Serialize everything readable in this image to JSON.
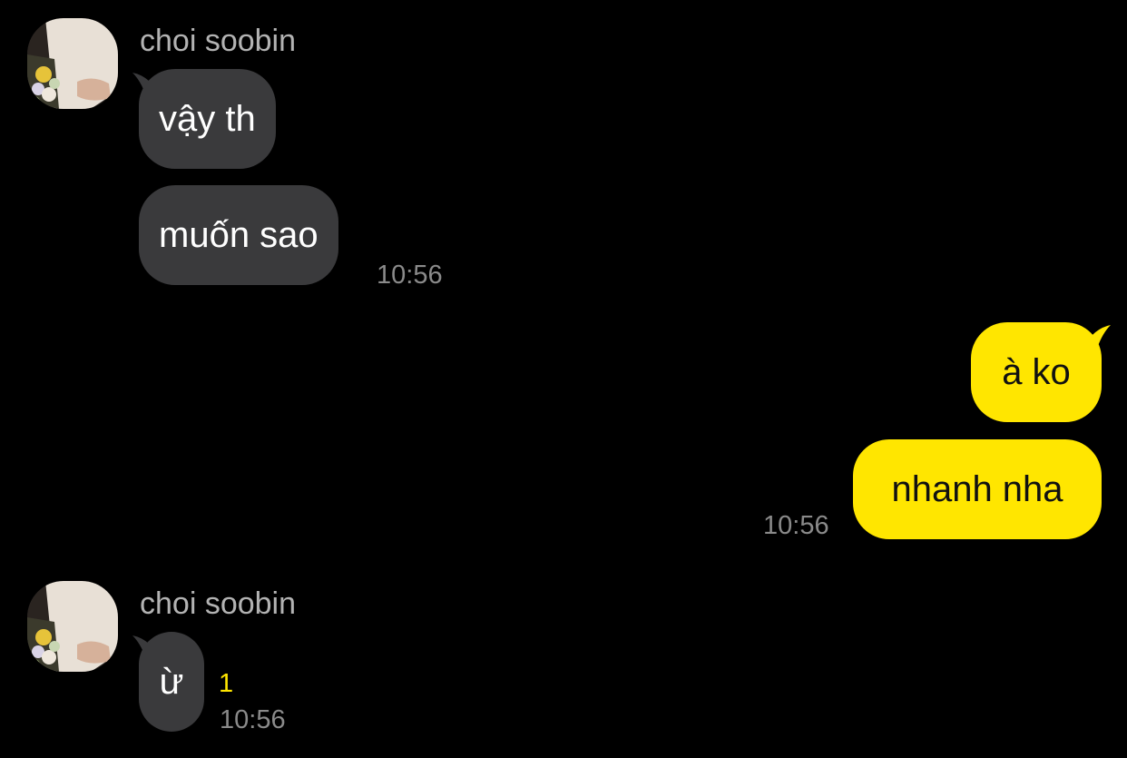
{
  "colors": {
    "background": "#000000",
    "incoming_bubble": "#3a3a3c",
    "outgoing_bubble": "#ffe600",
    "timestamp": "#8a8a8a",
    "sender_name": "#b3b3b3",
    "unread_count": "#ffe600"
  },
  "groups": [
    {
      "sender": "choi soobin",
      "avatar": "profile-photo-icon",
      "messages": [
        "vậy th",
        "muốn sao"
      ],
      "time": "10:56"
    },
    {
      "sender": "me",
      "messages": [
        "à ko",
        "nhanh nha"
      ],
      "time": "10:56"
    },
    {
      "sender": "choi soobin",
      "avatar": "profile-photo-icon",
      "messages": [
        "ừ"
      ],
      "unread": "1",
      "time": "10:56"
    }
  ]
}
